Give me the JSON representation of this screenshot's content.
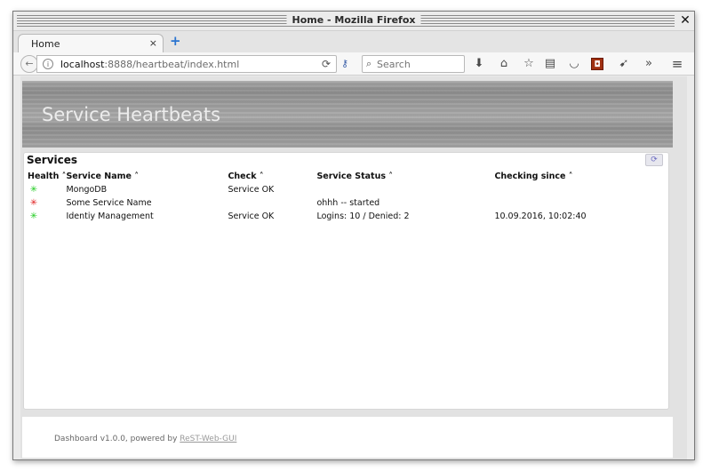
{
  "window": {
    "title": "Home - Mozilla Firefox",
    "close_glyph": "✕"
  },
  "tabs": [
    {
      "label": "Home",
      "close_glyph": "×"
    }
  ],
  "newtab_glyph": "+",
  "navbar": {
    "url_host": "localhost",
    "url_rest": ":8888/heartbeat/index.html",
    "search_placeholder": "Search",
    "icons": [
      "back-icon",
      "info-icon",
      "reload-icon",
      "key-icon",
      "download-icon",
      "home-icon",
      "bookmark-star-icon",
      "reading-list-icon",
      "pocket-icon",
      "extension-icon",
      "send-icon",
      "overflow-icon",
      "menu-icon"
    ]
  },
  "page": {
    "banner_title": "Service Heartbeats",
    "panel_title": "Services",
    "columns": [
      "Health ˄",
      "Service Name ˄",
      "Check ˄",
      "Service Status ˄",
      "Checking since ˄"
    ],
    "rows": [
      {
        "health_symbol": "✳",
        "health_color": "#22cc22",
        "name": "MongoDB",
        "check": "Service OK",
        "status": "",
        "since": ""
      },
      {
        "health_symbol": "✳",
        "health_color": "#e02020",
        "name": "Some Service Name",
        "check": "",
        "status": "ohhh -- started",
        "since": ""
      },
      {
        "health_symbol": "✳",
        "health_color": "#22cc22",
        "name": "Identiy Management",
        "check": "Service OK",
        "status": "Logins: 10 / Denied: 2",
        "since": "10.09.2016, 10:02:40"
      }
    ],
    "footer_text": "Dashboard v1.0.0, powered by ",
    "footer_link": "ReST-Web-GUI"
  },
  "colors": {
    "health_ok": "#22cc22",
    "health_error": "#e02020",
    "newtab_accent": "#2a74d0"
  }
}
